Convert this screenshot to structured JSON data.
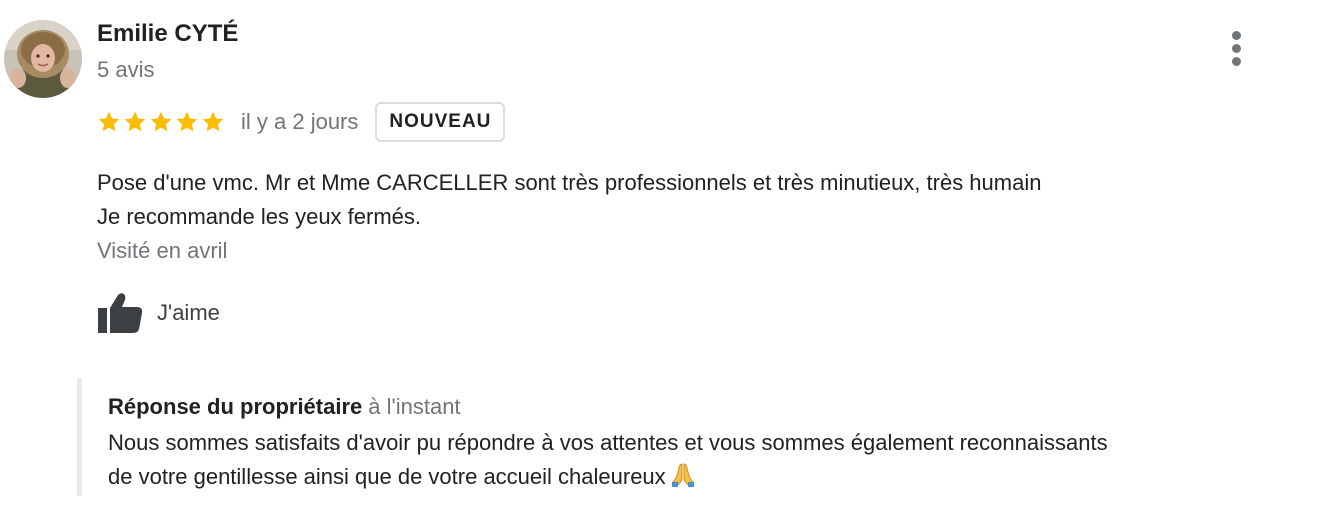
{
  "reviewer": {
    "name": "Emilie CYTÉ",
    "review_count": "5 avis"
  },
  "rating": {
    "stars": 5,
    "max_stars": 5,
    "star_color": "#fbbc04",
    "time_ago": "il y a 2 jours",
    "badge": "NOUVEAU"
  },
  "review": {
    "line1": "Pose d'une vmc. Mr et Mme CARCELLER sont très professionnels et très minutieux, très humain",
    "line2": "Je recommande les yeux fermés.",
    "visited": "Visité en avril"
  },
  "actions": {
    "like_label": "J'aime",
    "like_icon": "thumbs-up-icon",
    "more_icon": "more-vert-icon"
  },
  "owner_reply": {
    "title": "Réponse du propriétaire",
    "time": "à l'instant",
    "line1": "Nous sommes satisfaits d'avoir pu répondre à vos attentes et vous sommes également reconnaissants",
    "line2": "de votre gentillesse ainsi que de votre accueil chaleureux",
    "emoji_icon": "praying-hands-icon"
  }
}
